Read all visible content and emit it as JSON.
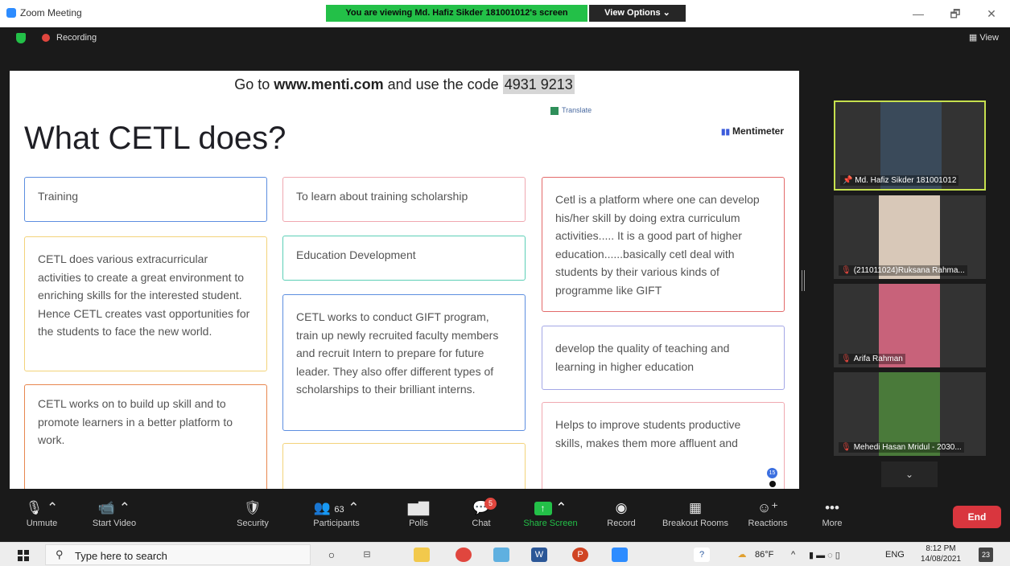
{
  "window": {
    "title": "Zoom Meeting",
    "viewing_banner": "You are viewing Md. Hafiz Sikder 181001012's screen",
    "view_options": "View Options ⌄",
    "minimize": "—",
    "maximize": "🗗",
    "close": "✕"
  },
  "topbar": {
    "recording": "Recording",
    "view": "View"
  },
  "slide": {
    "menti_prefix": "Go to ",
    "menti_url": "www.menti.com",
    "menti_middle": " and use the code ",
    "menti_code": "4931 9213",
    "translate": "Translate",
    "title": "What CETL does?",
    "brand": "Mentimeter",
    "cards": [
      "Training",
      "CETL does various extracurricular activities to create a great environment to enriching skills for the interested student. Hence CETL creates vast opportunities for the students to face the new world.",
      "CETL works on to build up skill and to promote learners in a better platform to work.",
      "To learn about training scholarship",
      "Education Development",
      "CETL works to conduct GIFT program, train up newly recruited faculty members and recruit Intern to prepare for future leader. They also offer different types of scholarships to their brilliant interns.",
      "",
      "Cetl is a platform where one can develop his/her skill by doing extra curriculum activities..... It is a good part of higher education......basically cetl deal with students by their various kinds of programme like GIFT",
      "develop the quality of teaching and learning in higher education",
      "Helps to improve students productive skills, makes them more affluent and"
    ],
    "audience_count": "15"
  },
  "participants": [
    {
      "name": "Md. Hafiz Sikder 181001012",
      "photo_color": "#3a4a5a"
    },
    {
      "name": "(211011024)Ruksana Rahma...",
      "photo_color": "#d8c8b8"
    },
    {
      "name": "Arifa Rahman",
      "photo_color": "#c8627a"
    },
    {
      "name": "Mehedi Hasan Mridul - 2030...",
      "photo_color": "#4a7a3a"
    }
  ],
  "toolbar": {
    "unmute": "Unmute",
    "start_video": "Start Video",
    "security": "Security",
    "participants": "Participants",
    "participants_count": "63",
    "polls": "Polls",
    "chat": "Chat",
    "chat_badge": "5",
    "share_screen": "Share Screen",
    "record": "Record",
    "breakout_rooms": "Breakout Rooms",
    "reactions": "Reactions",
    "more": "More",
    "end": "End"
  },
  "taskbar": {
    "search_placeholder": "Type here to search",
    "weather": "86°F",
    "lang": "ENG",
    "time": "8:12 PM",
    "date": "14/08/2021",
    "notifications": "23"
  }
}
